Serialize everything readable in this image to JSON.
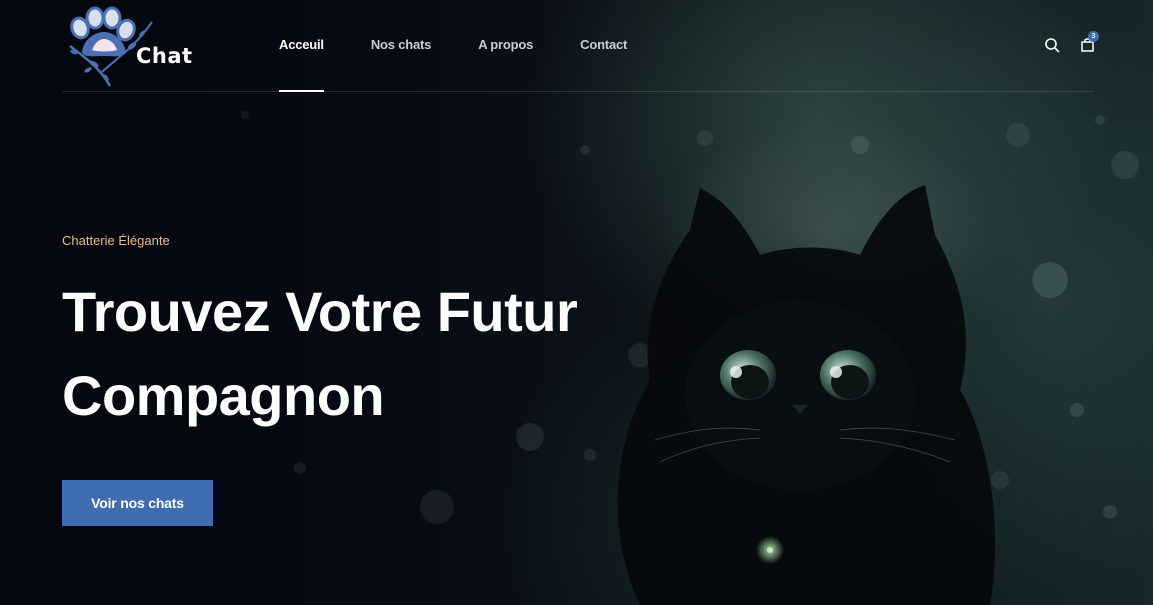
{
  "brand": {
    "name": "Chat",
    "logo_icon": "paw-print-icon"
  },
  "nav": {
    "items": [
      {
        "label": "Acceuil",
        "active": true
      },
      {
        "label": "Nos chats",
        "active": false
      },
      {
        "label": "A propos",
        "active": false
      },
      {
        "label": "Contact",
        "active": false
      }
    ]
  },
  "header_actions": {
    "search_icon": "search-icon",
    "cart_icon": "shopping-bag-icon",
    "cart_count": "3"
  },
  "hero": {
    "kicker": "Chatterie Élégante",
    "headline": "Trouvez Votre Futur Compagnon",
    "cta_label": "Voir nos chats",
    "background": "black-cat-painting"
  },
  "colors": {
    "accent": "#3f6db0",
    "kicker": "#e9b98a",
    "text": "#ffffff",
    "nav_text": "#c9ccd1",
    "background": "#070a12"
  }
}
